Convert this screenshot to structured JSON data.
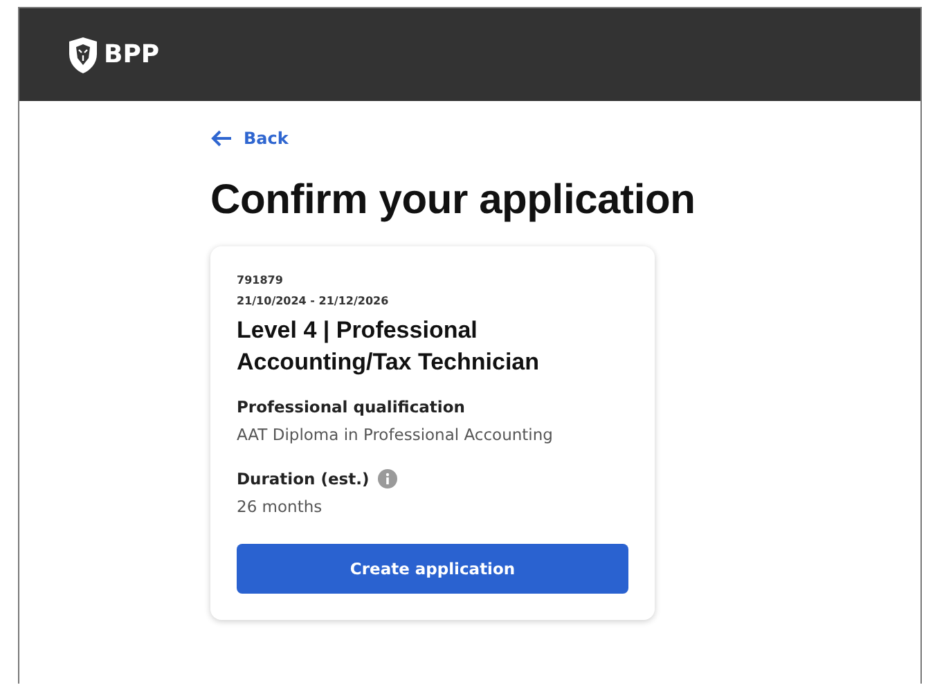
{
  "header": {
    "logo_text": "BPP"
  },
  "back_link": "Back",
  "title": "Confirm your application",
  "card": {
    "code": "791879",
    "dates": "21/10/2024 - 21/12/2026",
    "course": "Level 4 | Professional Accounting/Tax Technician",
    "fields": [
      {
        "label": "Professional qualification",
        "value": "AAT Diploma in Professional Accounting",
        "info": false
      },
      {
        "label": "Duration (est.)",
        "value": "26 months",
        "info": true
      }
    ],
    "button": "Create application"
  }
}
